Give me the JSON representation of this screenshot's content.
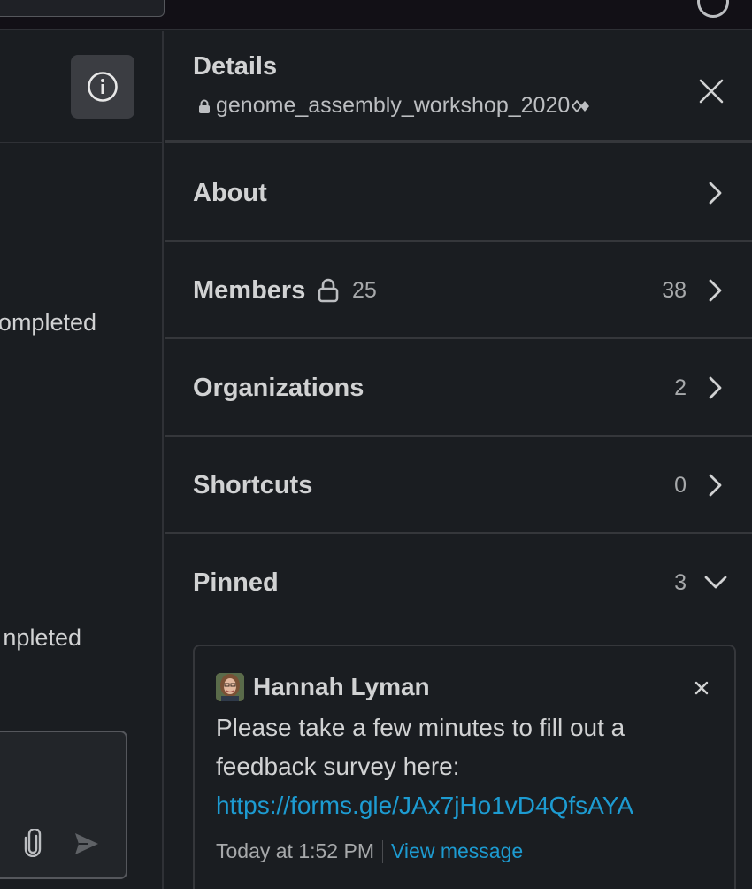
{
  "channel_pane": {
    "snippet_1": "ompleted",
    "snippet_2": "npleted"
  },
  "details": {
    "title": "Details",
    "channel_name": "genome_assembly_workshop_2020",
    "sections": [
      {
        "label": "About",
        "count": ""
      },
      {
        "label": "Members",
        "lock_count": "25",
        "count": "38"
      },
      {
        "label": "Organizations",
        "count": "2"
      },
      {
        "label": "Shortcuts",
        "count": "0"
      },
      {
        "label": "Pinned",
        "count": "3"
      }
    ]
  },
  "pinned_message": {
    "author": "Hannah Lyman",
    "text": "Please take a few minutes to fill out a feedback survey here:",
    "link": "https://forms.gle/JAx7jHo1vD4QfsAYA",
    "timestamp": "Today at 1:52 PM",
    "view_message_label": "View message"
  },
  "colors": {
    "background": "#1a1d21",
    "topbar": "#121016",
    "link": "#1d9bd1",
    "divider": "#35373b"
  },
  "icons": {
    "info": "info-icon",
    "close": "close-icon",
    "lock": "lock-icon",
    "chevron_right": "chevron-right-icon",
    "chevron_down": "chevron-down-icon",
    "attach": "paperclip-icon",
    "send": "send-icon"
  }
}
